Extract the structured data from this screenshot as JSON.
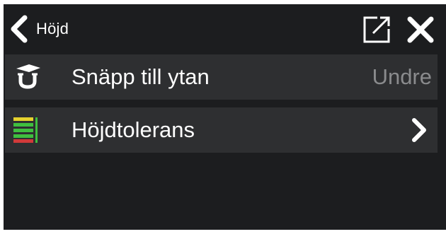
{
  "header": {
    "title": "Höjd",
    "back_icon": "chevron-left-icon",
    "popout_icon": "external-link-icon",
    "close_icon": "close-icon"
  },
  "rows": [
    {
      "label": "Snäpp till ytan",
      "value": "Undre",
      "icon": "surface-snap-icon"
    },
    {
      "label": "Höjdtolerans",
      "icon": "tolerance-bars-icon",
      "trailing_icon": "chevron-right-icon"
    }
  ],
  "colors": {
    "panel_bg": "#1c1d1f",
    "row_bg": "#2e2f31",
    "text": "#ffffff",
    "value_text": "#8a8b8d",
    "tolerance_green": "#3fbf3f",
    "tolerance_yellow": "#e6d22e",
    "tolerance_red": "#d23a3a"
  }
}
